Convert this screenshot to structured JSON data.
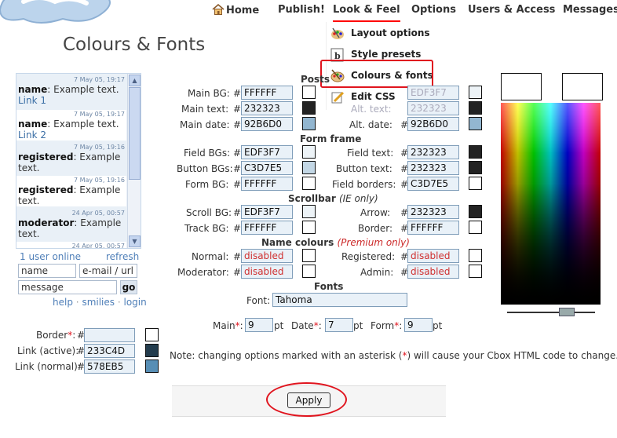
{
  "nav": {
    "home": "Home",
    "publish": "Publish!",
    "look_feel": "Look & Feel",
    "options": "Options",
    "users_access": "Users & Access",
    "messages": "Messages"
  },
  "dropdown": {
    "items": [
      {
        "label": "Layout options",
        "icon": "layout-icon"
      },
      {
        "label": "Style presets",
        "icon": "presets-icon"
      },
      {
        "label": "Colours & fonts",
        "icon": "palette-icon"
      },
      {
        "label": "Edit CSS",
        "icon": "edit-css-icon"
      }
    ]
  },
  "page_title": "Colours & Fonts",
  "chat": {
    "messages": [
      {
        "time": "7 May 05, 19:17",
        "name": "name",
        "text": ": Example text.",
        "link": "Link 1"
      },
      {
        "time": "7 May 05, 19:17",
        "name": "name",
        "text": ": Example text.",
        "link": "Link 2"
      },
      {
        "time": "7 May 05, 19:16",
        "name": "registered",
        "text": ": Example text.",
        "link": ""
      },
      {
        "time": "7 May 05, 19:16",
        "name": "registered",
        "text": ": Example text.",
        "link": ""
      },
      {
        "time": "24 Apr 05, 00:57",
        "name": "moderator",
        "text": ": Example text.",
        "link": ""
      },
      {
        "time": "24 Apr 05, 00:57",
        "name": "",
        "text": "",
        "link": ""
      }
    ],
    "users_online": "1 user online",
    "refresh": "refresh",
    "name_placeholder": "name",
    "email_placeholder": "e-mail / url",
    "message_placeholder": "message",
    "go": "go",
    "help": "help",
    "smilies": "smilies",
    "login": "login",
    "sep": "·"
  },
  "left_colors": {
    "border_label": "Border",
    "border_value": "",
    "link_active_label": "Link (active):",
    "link_active_value": "233C4D",
    "link_normal_label": "Link (normal):",
    "link_normal_value": "578EB5",
    "colors": {
      "border": "#ffffff",
      "link_active": "#233C4D",
      "link_normal": "#578EB5"
    }
  },
  "posts": {
    "section": "Posts",
    "main_bg_label": "Main BG:",
    "main_bg_value": "FFFFFF",
    "main_text_label": "Main text:",
    "main_text_value": "232323",
    "main_date_label": "Main date:",
    "main_date_value": "92B6D0",
    "alt_bg_value": "EDF3F7",
    "alt_text_label": "Alt. text:",
    "alt_text_value": "232323",
    "alt_date_label": "Alt. date:",
    "alt_date_value": "92B6D0"
  },
  "form_frame": {
    "section": "Form frame",
    "field_bgs_label": "Field BGs:",
    "field_bgs_value": "EDF3F7",
    "button_bgs_label": "Button BGs:",
    "button_bgs_value": "C3D7E5",
    "form_bg_label": "Form BG:",
    "form_bg_value": "FFFFFF",
    "field_text_label": "Field text:",
    "field_text_value": "232323",
    "button_text_label": "Button text:",
    "button_text_value": "232323",
    "field_borders_label": "Field borders:",
    "field_borders_value": "C3D7E5"
  },
  "scrollbar": {
    "section": "Scrollbar",
    "note": "(IE only)",
    "scroll_bg_label": "Scroll BG:",
    "scroll_bg_value": "EDF3F7",
    "track_bg_label": "Track BG:",
    "track_bg_value": "FFFFFF",
    "arrow_label": "Arrow:",
    "arrow_value": "232323",
    "border_label": "Border:",
    "border_value": "FFFFFF"
  },
  "name_colours": {
    "section": "Name colours",
    "note": "(Premium only)",
    "normal_label": "Normal:",
    "normal_value": "disabled",
    "moderator_label": "Moderator:",
    "moderator_value": "disabled",
    "registered_label": "Registered:",
    "registered_value": "disabled",
    "admin_label": "Admin:",
    "admin_value": "disabled"
  },
  "fonts": {
    "section": "Fonts",
    "font_label": "Font:",
    "font_value": "Tahoma",
    "main_label": "Main",
    "main_value": "9",
    "date_label": "Date",
    "date_value": "7",
    "form_label": "Form",
    "form_value": "9",
    "unit": "pt"
  },
  "note": {
    "before": "Note: changing options marked with an asterisk (",
    "star": "*",
    "after": ") will cause your Cbox HTML code to change."
  },
  "apply": "Apply",
  "symbols": {
    "hash": "#",
    "star": "*",
    "colon": ":"
  }
}
